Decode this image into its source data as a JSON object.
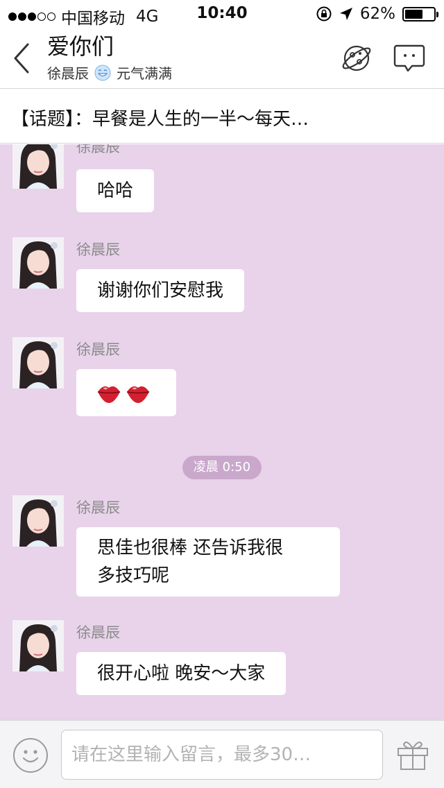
{
  "status_bar": {
    "carrier": "中国移动",
    "network": "4G",
    "time": "10:40",
    "battery": "62%",
    "battery_level": 0.62,
    "signal_dots": 5,
    "signal_filled": 3
  },
  "header": {
    "title": "爱你们",
    "sender_name": "徐晨辰",
    "mood": "元气满满"
  },
  "topic": {
    "text": "【话题】：早餐是人生的一半～每天…"
  },
  "chat": {
    "background": "#e8d3ea",
    "time_divider": "凌晨 0:50",
    "messages": [
      {
        "sender": "徐晨辰",
        "text": "哈哈"
      },
      {
        "sender": "徐晨辰",
        "text": "谢谢你们安慰我"
      },
      {
        "sender": "徐晨辰",
        "text": "",
        "emoji": "kiss-lips"
      },
      {
        "sender": "徐晨辰",
        "lines": [
          "思佳也很棒 还告诉我很",
          "多技巧呢"
        ]
      },
      {
        "sender": "徐晨辰",
        "text": "很开心啦 晚安～大家"
      }
    ]
  },
  "input_bar": {
    "placeholder": "请在这里输入留言，最多30…"
  },
  "icons": {
    "back": "chevron-left-icon",
    "planet": "planet-icon",
    "chat": "chat-bubble-icon",
    "emoji": "smiley-icon",
    "gift": "gift-icon",
    "mood": "smile-face-icon"
  }
}
